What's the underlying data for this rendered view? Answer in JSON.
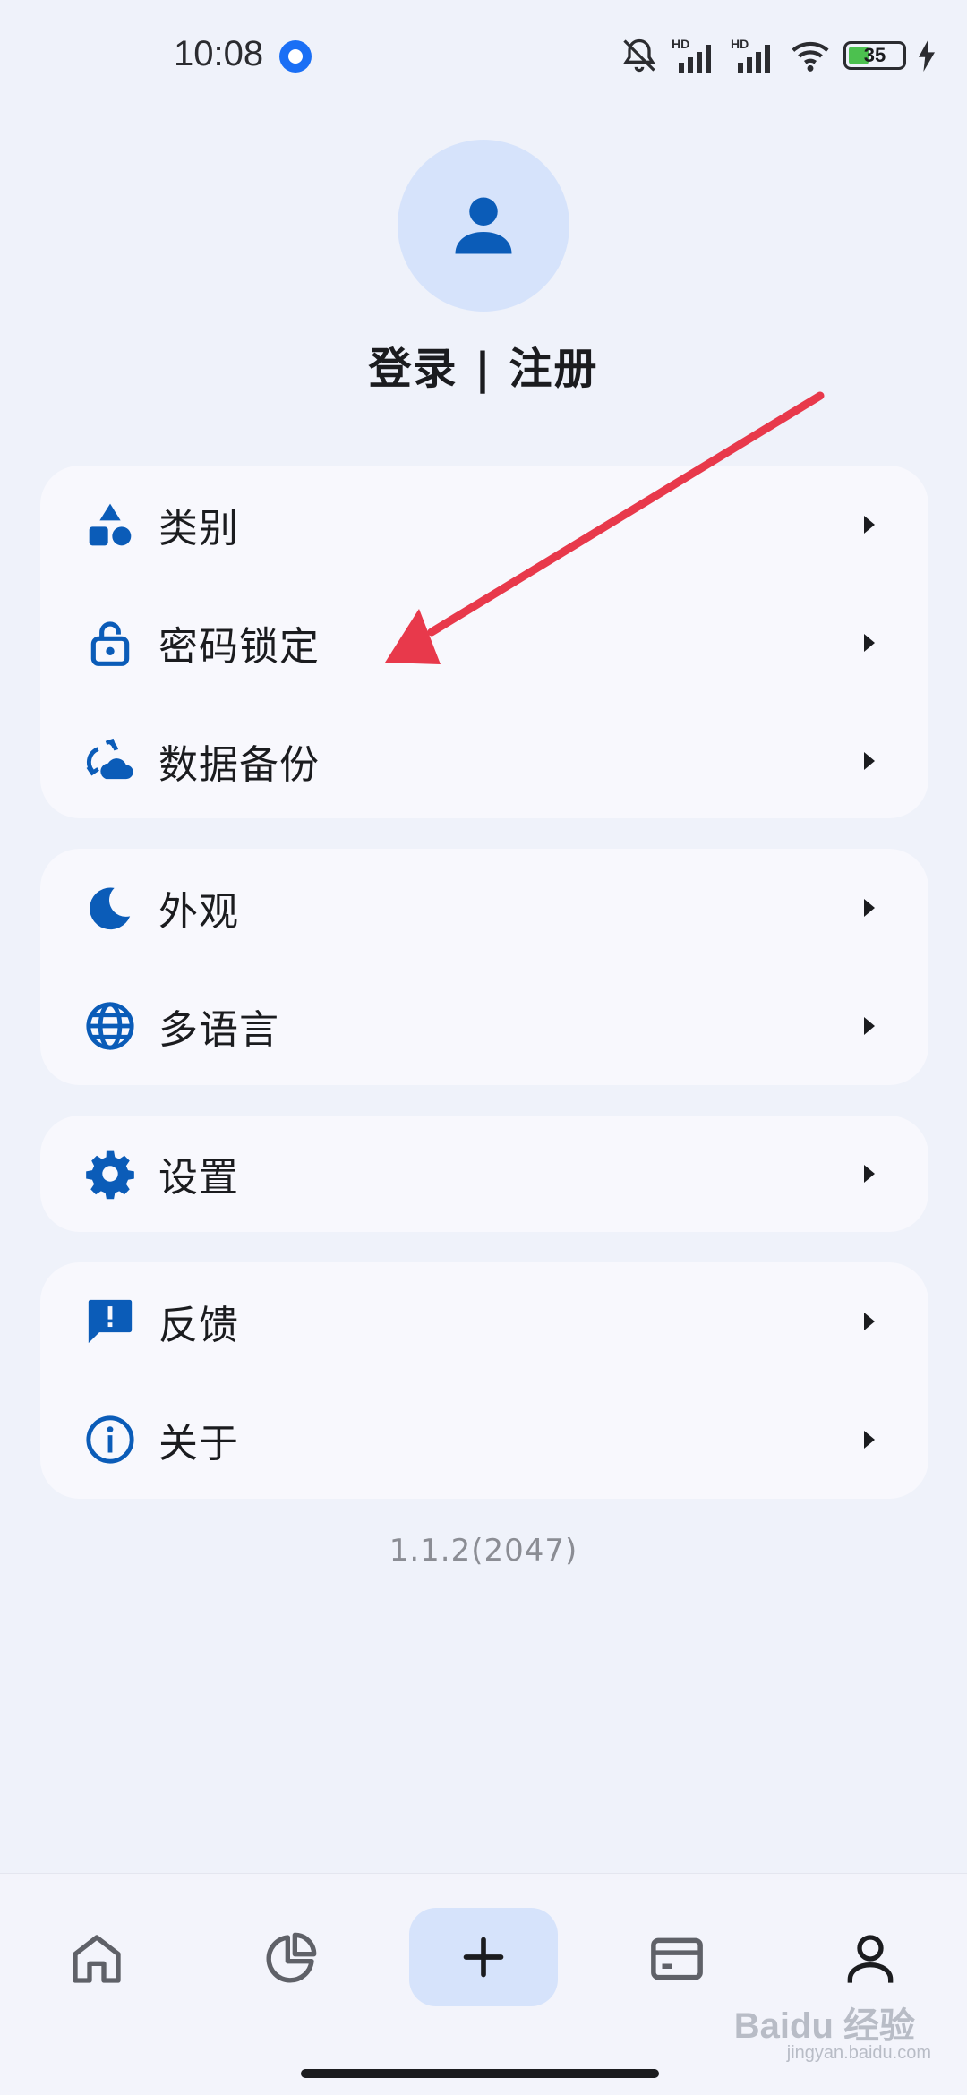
{
  "status_bar": {
    "time": "10:08",
    "battery_level": "35",
    "icons": [
      "mute-icon",
      "hd-signal-icon",
      "hd-signal-icon",
      "wifi-icon",
      "battery-icon",
      "charging-icon"
    ]
  },
  "profile": {
    "title": "登录 | 注册",
    "avatar_icon": "person-icon"
  },
  "menu_groups": [
    {
      "items": [
        {
          "label": "类别",
          "icon": "shapes-icon"
        },
        {
          "label": "密码锁定",
          "icon": "lock-open-icon"
        },
        {
          "label": "数据备份",
          "icon": "cloud-sync-icon"
        }
      ]
    },
    {
      "items": [
        {
          "label": "外观",
          "icon": "moon-icon"
        },
        {
          "label": "多语言",
          "icon": "globe-icon"
        }
      ]
    },
    {
      "items": [
        {
          "label": "设置",
          "icon": "gear-icon"
        }
      ]
    },
    {
      "items": [
        {
          "label": "反馈",
          "icon": "feedback-icon"
        },
        {
          "label": "关于",
          "icon": "info-icon"
        }
      ]
    }
  ],
  "version": "1.1.2(2047)",
  "bottom_nav": {
    "items": [
      "home-icon",
      "chart-icon",
      "add-icon",
      "card-icon",
      "profile-icon"
    ],
    "selected": "profile-icon"
  },
  "watermark": {
    "brand": "Baidu 经验",
    "sub": "jingyan.baidu.com"
  },
  "colors": {
    "accent": "#0b5cb8",
    "avatar_bg": "#d6e3fb",
    "annotation_arrow": "#e8394b",
    "background": "#eff2fa",
    "card": "#f8f8fd"
  }
}
